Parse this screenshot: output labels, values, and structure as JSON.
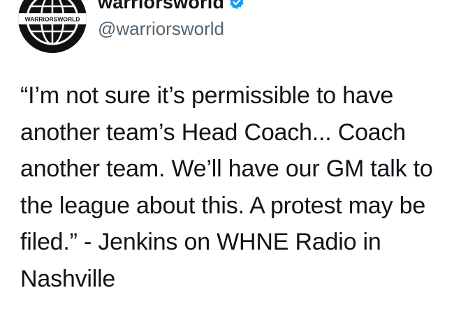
{
  "account": {
    "display_name": "warriorsworld",
    "handle": "@warriorsworld",
    "avatar_text": "WARRIORSWORLD",
    "verified": true
  },
  "tweet": {
    "text": "“I’m not sure it’s permissible to have another team’s Head Coach... Coach another team.  We’ll have our GM talk to the league about this.  A protest may be filed.” - Jenkins on WHNE Radio in Nashville"
  },
  "icons": {
    "verified": "verified-badge-icon",
    "more": "more-options-icon"
  },
  "colors": {
    "verified": "#1d9bf0",
    "text": "#0f1419",
    "handle": "#536471"
  }
}
